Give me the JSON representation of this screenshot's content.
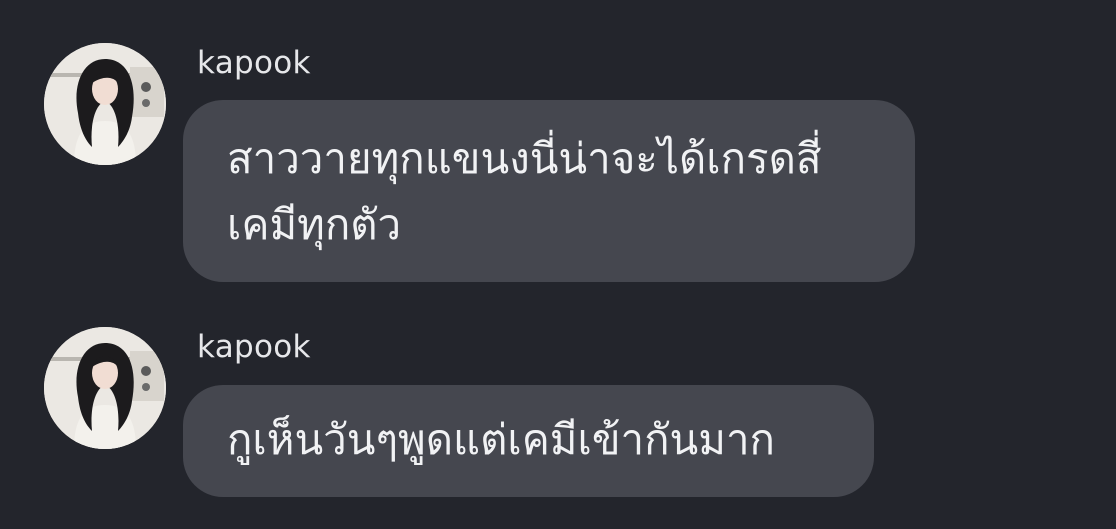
{
  "colors": {
    "background": "#23252c",
    "bubble": "#45474f",
    "sender_text": "#e6e7ea",
    "message_text": "#f1f2f4"
  },
  "messages": [
    {
      "sender": "kapook",
      "avatar_icon": "user-avatar-photo",
      "lines": [
        "สาววายทุกแขนงนี่น่าจะได้เกรดสี่",
        "เคมีทุกตัว"
      ]
    },
    {
      "sender": "kapook",
      "avatar_icon": "user-avatar-photo",
      "lines": [
        "กูเห็นวันๆพูดแต่เคมีเข้ากันมาก"
      ]
    }
  ]
}
